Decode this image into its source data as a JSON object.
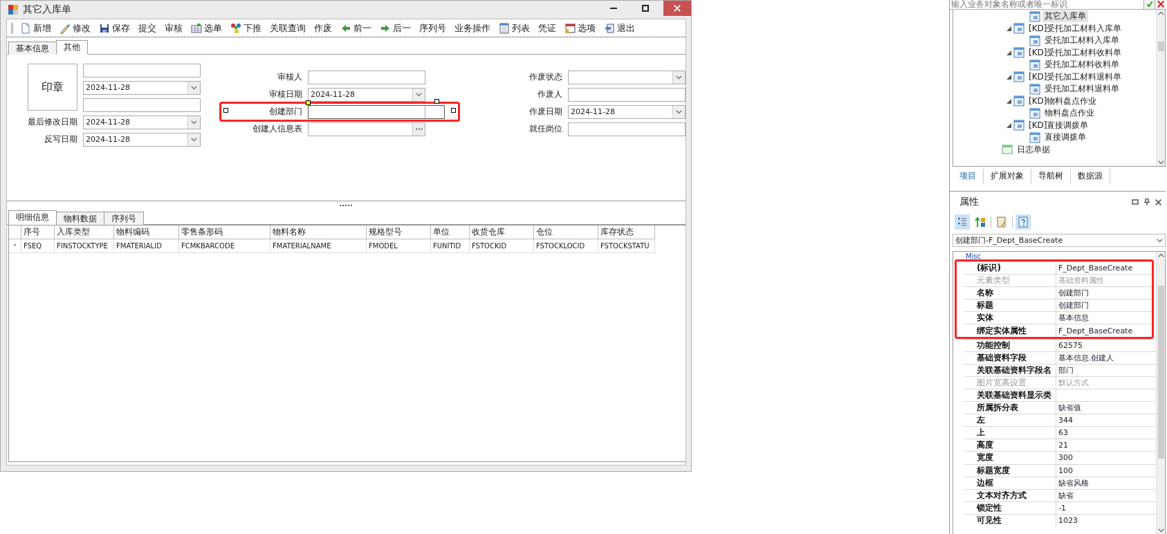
{
  "window": {
    "title": "其它入库单"
  },
  "toolbar": [
    {
      "label": "新增",
      "kind": "icon"
    },
    {
      "label": "修改",
      "kind": "icon"
    },
    {
      "label": "保存",
      "kind": "icon"
    },
    {
      "label": "提交",
      "kind": "text"
    },
    {
      "label": "审核",
      "kind": "text"
    },
    {
      "label": "选单",
      "kind": "icon"
    },
    {
      "label": "下推",
      "kind": "icon"
    },
    {
      "label": "关联查询",
      "kind": "text"
    },
    {
      "label": "作废",
      "kind": "text"
    },
    {
      "label": "前一",
      "kind": "icon"
    },
    {
      "label": "后一",
      "kind": "icon"
    },
    {
      "label": "序列号",
      "kind": "text"
    },
    {
      "label": "业务操作",
      "kind": "text"
    },
    {
      "label": "列表",
      "kind": "icon"
    },
    {
      "label": "凭证",
      "kind": "text"
    },
    {
      "label": "选项",
      "kind": "icon"
    },
    {
      "label": "退出",
      "kind": "icon"
    }
  ],
  "header_tabs": [
    {
      "label": "基本信息",
      "selected": false
    },
    {
      "label": "其他",
      "selected": true
    }
  ],
  "form": {
    "stamp": {
      "label": "印章"
    },
    "columns": [
      {
        "fields": [
          {
            "kind": "text"
          },
          {
            "kind": "combo",
            "value": "2024-11-28"
          },
          {
            "kind": "text"
          },
          {
            "label": "最后修改日期",
            "kind": "combo",
            "value": "2024-11-28"
          },
          {
            "label": "反写日期",
            "kind": "combo",
            "value": "2024-11-28"
          }
        ]
      },
      {
        "fields": [
          {
            "label": "审核人",
            "kind": "text"
          },
          {
            "label": "审核日期",
            "kind": "combo",
            "value": "2024-11-28"
          },
          {
            "label": "创建部门",
            "kind": "text",
            "selected": true,
            "highlighted": true
          },
          {
            "label": "创建人信息表",
            "kind": "lookup"
          }
        ]
      },
      {
        "fields": [
          {
            "label": "作废状态",
            "kind": "combo"
          },
          {
            "label": "作废人",
            "kind": "text"
          },
          {
            "label": "作废日期",
            "kind": "combo",
            "value": "2024-11-28"
          },
          {
            "label": "就任岗位",
            "kind": "text"
          }
        ]
      }
    ]
  },
  "detail_tabs": [
    {
      "label": "明细信息",
      "selected": true
    },
    {
      "label": "物料数据",
      "selected": false
    },
    {
      "label": "序列号",
      "selected": false
    }
  ],
  "table": {
    "columns": [
      "序号",
      "入库类型",
      "物料编码",
      "零售条形码",
      "物料名称",
      "规格型号",
      "单位",
      "收货仓库",
      "仓位",
      "库存状态"
    ],
    "rows": [
      {
        "marker": "*",
        "cells": [
          "FSEQ",
          "FINSTOCKTYPE",
          "FMATERIALID",
          "FCMKBARCODE",
          "FMATERIALNAME",
          "FMODEL",
          "FUNITID",
          "FSTOCKID",
          "FSTOCKLOCID",
          "FSTOCKSTATU"
        ]
      }
    ]
  },
  "object_search": {
    "placeholder": "输入业务对象名称或者唯一标识"
  },
  "tree": [
    {
      "children": [
        {
          "children": [
            {
              "label": "其它入库单",
              "selected": true
            }
          ]
        },
        {
          "label": "[KD]受托加工材料入库单",
          "expanded": true,
          "children": [
            {
              "label": "受托加工材料入库单",
              "selected": false
            }
          ]
        },
        {
          "label": "[KD]受托加工材料收料单",
          "expanded": true,
          "children": [
            {
              "label": "受托加工材料收料单",
              "selected": false
            }
          ]
        },
        {
          "label": "[KD]受托加工材料退料单",
          "expanded": true,
          "children": [
            {
              "label": "受托加工材料退料单",
              "selected": false
            }
          ]
        },
        {
          "label": "[KD]物料盘点作业",
          "expanded": true,
          "children": [
            {
              "label": "物料盘点作业",
              "selected": false
            }
          ]
        },
        {
          "label": "[KD]直接调拨单",
          "expanded": true,
          "children": [
            {
              "label": "直接调拨单",
              "selected": false
            }
          ]
        }
      ]
    },
    {
      "label": "日志单据",
      "selected": false
    }
  ],
  "explorer_tabs": [
    {
      "label": "项目",
      "selected": true
    },
    {
      "label": "扩展对象",
      "selected": false
    },
    {
      "label": "导航树",
      "selected": false
    },
    {
      "label": "数据源",
      "selected": false
    }
  ],
  "properties": {
    "title": "属性",
    "tools": [
      {
        "pressed": true
      },
      {
        "pressed": false
      },
      {
        "pressed": false
      },
      {
        "pressed": true
      }
    ],
    "object": "创建部门-F_Dept_BaseCreate",
    "category": "Misc",
    "highlighted_rows": [
      {
        "name": "(标识)",
        "value": "F_Dept_BaseCreate",
        "disabled": false
      },
      {
        "name": "元素类型",
        "value": "基础资料属性",
        "disabled": true
      },
      {
        "name": "名称",
        "value": "创建部门",
        "disabled": false
      },
      {
        "name": "标题",
        "value": "创建部门",
        "disabled": false
      },
      {
        "name": "实体",
        "value": "基本信息",
        "disabled": false
      },
      {
        "name": "绑定实体属性",
        "value": "F_Dept_BaseCreate",
        "disabled": false
      }
    ],
    "rows": [
      {
        "name": "功能控制",
        "value": "62575",
        "disabled": false
      },
      {
        "name": "基础资料字段",
        "value": "基本信息.创建人",
        "disabled": false
      },
      {
        "name": "关联基础资料字段名",
        "value": "部门",
        "disabled": false
      },
      {
        "name": "图片宽高设置",
        "value": "默认方式",
        "disabled": true
      },
      {
        "name": "关联基础资料显示类",
        "disabled": false
      },
      {
        "name": "所属拆分表",
        "value": "缺省值",
        "disabled": false
      },
      {
        "name": "左",
        "value": "344",
        "disabled": false
      },
      {
        "name": "上",
        "value": "63",
        "disabled": false
      },
      {
        "name": "高度",
        "value": "21",
        "disabled": false
      },
      {
        "name": "宽度",
        "value": "300",
        "disabled": false
      },
      {
        "name": "标题宽度",
        "value": "100",
        "disabled": false
      },
      {
        "name": "边框",
        "value": "缺省风格",
        "disabled": false
      },
      {
        "name": "文本对齐方式",
        "value": "缺省",
        "disabled": false
      },
      {
        "name": "锁定性",
        "value": "-1",
        "disabled": false
      },
      {
        "name": "可见性",
        "value": "1023",
        "disabled": false
      }
    ]
  }
}
